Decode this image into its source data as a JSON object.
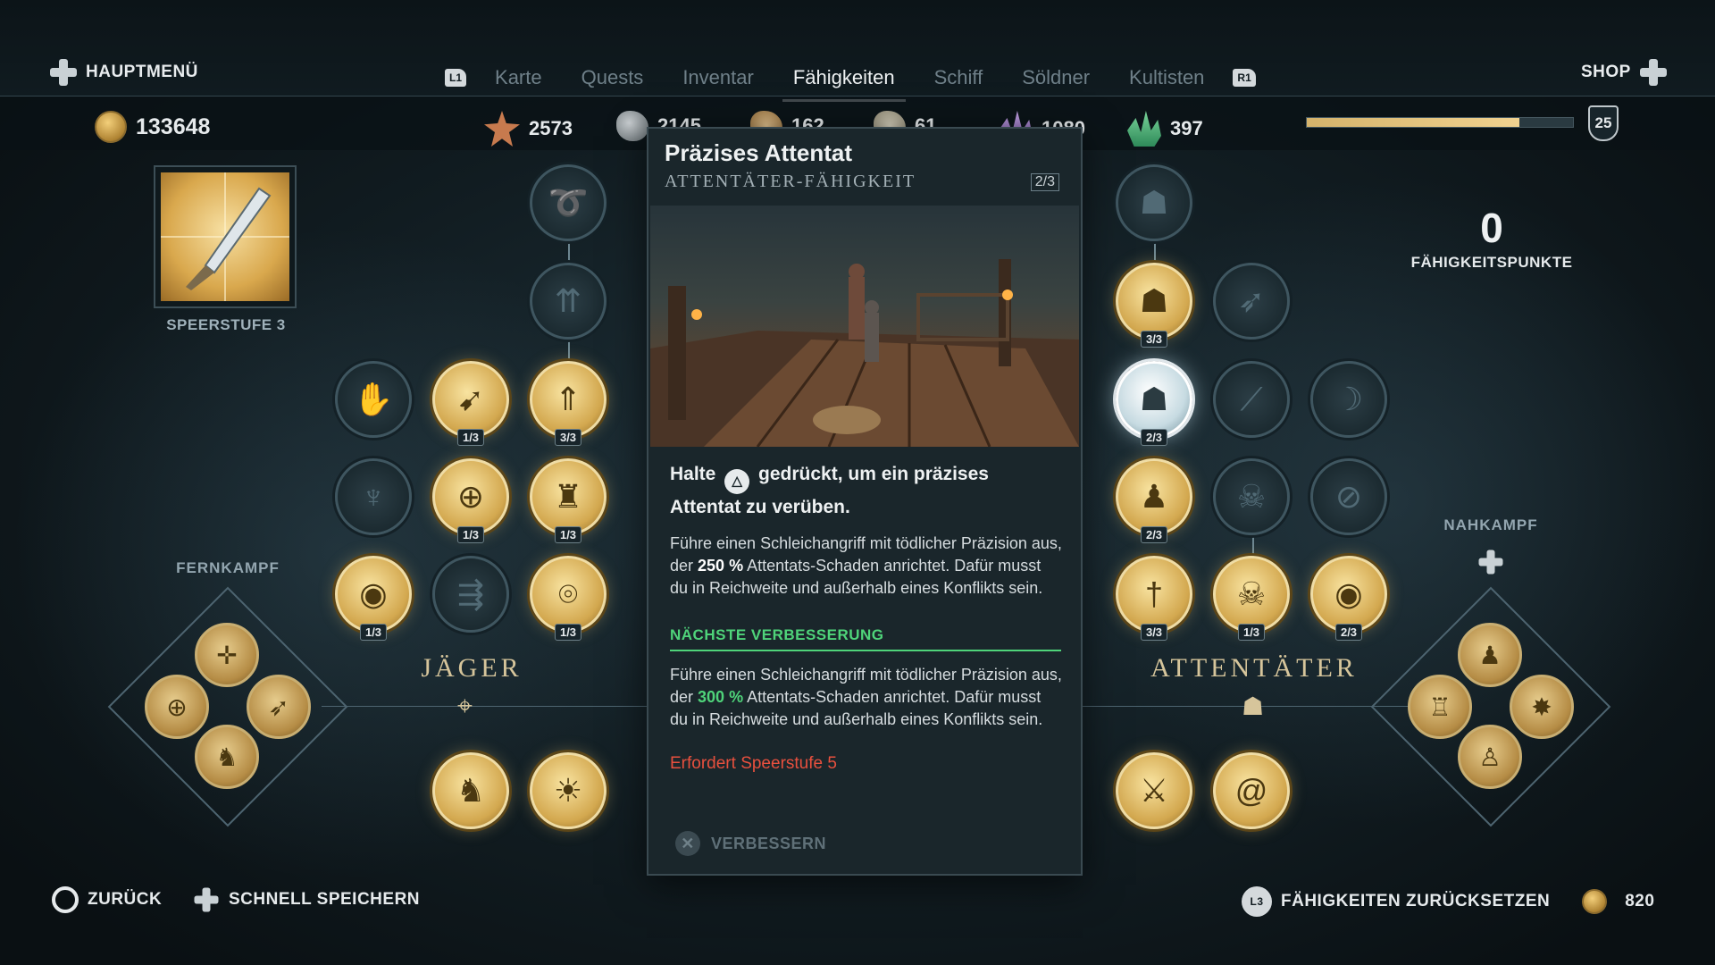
{
  "topbar": {
    "main_menu": "HAUPTMENÜ",
    "shop": "SHOP",
    "left_shoulder": "L1",
    "right_shoulder": "R1",
    "tabs": [
      "Karte",
      "Quests",
      "Inventar",
      "Fähigkeiten",
      "Schiff",
      "Söldner",
      "Kultisten"
    ],
    "active_tab": "Fähigkeiten"
  },
  "resources": {
    "drachmae": "133648",
    "leather": "2573",
    "iron": "2145",
    "wood": "162",
    "olive": "61",
    "amethyst": "1080",
    "crystal": "397",
    "xp_progress": 0.8,
    "level": "25"
  },
  "left": {
    "spear_label": "SPEERSTUFE 3",
    "branch_ranged": "FERNKAMPF",
    "tree_title": "JÄGER"
  },
  "right": {
    "ability_points": "0",
    "ability_points_label": "FÄHIGKEITSPUNKTE",
    "branch_melee": "NAHKAMPF",
    "tree_title": "ATTENTÄTER"
  },
  "hunter_nodes": [
    {
      "icon": "spiral-arrow-icon",
      "state": "locked",
      "rank": ""
    },
    {
      "icon": "triple-arrow-icon",
      "state": "locked",
      "rank": ""
    },
    {
      "icon": "hand-icon",
      "state": "locked",
      "rank": ""
    },
    {
      "icon": "multi-arrow-icon",
      "state": "unlocked",
      "rank": "1/3"
    },
    {
      "icon": "laurel-arrow-icon",
      "state": "unlocked",
      "rank": "3/3"
    },
    {
      "icon": "laurel-spear-icon",
      "state": "locked",
      "rank": ""
    },
    {
      "icon": "crosshair-icon",
      "state": "unlocked",
      "rank": "1/3"
    },
    {
      "icon": "hunter-icon",
      "state": "unlocked",
      "rank": "1/3"
    },
    {
      "icon": "eye-target-icon",
      "state": "unlocked",
      "rank": "1/3"
    },
    {
      "icon": "volley-icon",
      "state": "locked",
      "rank": ""
    },
    {
      "icon": "target-person-icon",
      "state": "unlocked",
      "rank": "1/3"
    }
  ],
  "assassin_nodes": [
    {
      "icon": "crouch-icon",
      "state": "locked",
      "rank": ""
    },
    {
      "icon": "hood-laurel-icon",
      "state": "unlocked",
      "rank": "3/3"
    },
    {
      "icon": "sprint-icon",
      "state": "locked",
      "rank": ""
    },
    {
      "icon": "assassinate-icon",
      "state": "selected",
      "rank": "2/3"
    },
    {
      "icon": "blade-icon",
      "state": "locked",
      "rank": ""
    },
    {
      "icon": "shadow-icon",
      "state": "locked",
      "rank": ""
    },
    {
      "icon": "hooded-figure-icon",
      "state": "unlocked",
      "rank": "2/3"
    },
    {
      "icon": "skull-icon",
      "state": "locked",
      "rank": ""
    },
    {
      "icon": "hidden-eye-icon",
      "state": "locked",
      "rank": ""
    },
    {
      "icon": "laurel-dagger-icon",
      "state": "unlocked",
      "rank": "3/3"
    },
    {
      "icon": "skull-crossbones-icon",
      "state": "unlocked",
      "rank": "1/3"
    },
    {
      "icon": "eye-shield-icon",
      "state": "unlocked",
      "rank": "2/3"
    }
  ],
  "bottom_abilities": [
    {
      "icon": "horse-icon"
    },
    {
      "icon": "sun-icon"
    },
    {
      "icon": "swords-icon"
    },
    {
      "icon": "swirl-icon"
    }
  ],
  "tooltip": {
    "title": "Präzises Attentat",
    "subtitle": "ATTENTÄTER-FÄHIGKEIT",
    "rank": "2/3",
    "action_pre": "Halte",
    "action_post": "gedrückt, um ein präzises Attentat zu verüben.",
    "desc_pre": "Führe einen Schleichangriff mit tödlicher Präzision aus, der",
    "desc_value": "250 %",
    "desc_post": "Attentats-Schaden anrichtet. Dafür musst du in Reichweite und außerhalb eines Konflikts sein.",
    "next_label": "NÄCHSTE VERBESSERUNG",
    "next_pre": "Führe einen Schleichangriff mit tödlicher Präzision aus, der",
    "next_value": "300 %",
    "next_post": "Attentats-Schaden anrichtet. Dafür musst du in Reichweite und außerhalb eines Konflikts sein.",
    "requirement": "Erfordert Speerstufe 5",
    "upgrade": "VERBESSERN"
  },
  "bottombar": {
    "back": "ZURÜCK",
    "quicksave": "SCHNELL SPEICHERN",
    "reset": "FÄHIGKEITEN ZURÜCKSETZEN",
    "reset_l3": "L3",
    "reset_cost": "820"
  },
  "colors": {
    "accent_gold": "#d3a84f",
    "next_green": "#4fd47a",
    "warning_red": "#e8503e"
  }
}
